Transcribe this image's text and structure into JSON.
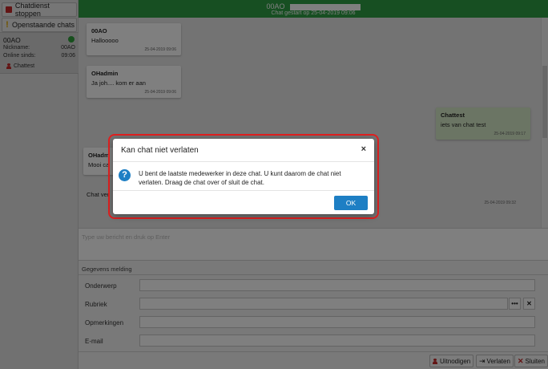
{
  "sidebar": {
    "stop_button": "Chatdienst stoppen",
    "open_chats_button": "Openstaande chats",
    "active_chat": {
      "id": "00AO",
      "status_color": "#2e9e3a",
      "nickname_label": "Nickname:",
      "nickname_value": "00AO",
      "online_label": "Online sinds:",
      "online_value": "09:06",
      "user": "Chattest"
    }
  },
  "header": {
    "title": "00AO",
    "subtitle": "Chat gestart op 25-04-2019 09:06",
    "color": "#2e9e45"
  },
  "messages": [
    {
      "from": "00AO",
      "text": "Hallooooo",
      "time": "25-04-2019 09:06"
    },
    {
      "from": "OHadmin",
      "text": "Ja joh.... kom er aan",
      "time": "25-04-2019 09:06"
    },
    {
      "from": "Chattest",
      "text": "iets van chat test",
      "time": "25-04-2019 09:17"
    },
    {
      "from": "OHadm",
      "text": "Mooi ca",
      "time": ""
    }
  ],
  "status_line": {
    "text": "Chat ver",
    "time": "25-04-2019 09:32"
  },
  "input": {
    "placeholder": "Type uw bericht en druk op Enter"
  },
  "form": {
    "title": "Gegevens melding",
    "fields": [
      {
        "label": "Onderwerp"
      },
      {
        "label": "Rubriek",
        "more": "•••",
        "clear": "✕"
      },
      {
        "label": "Opmerkingen"
      },
      {
        "label": "E-mail"
      }
    ]
  },
  "footer": {
    "invite": "Uitnodigen",
    "leave": "Verlaten",
    "close": "Sluiten"
  },
  "modal": {
    "title": "Kan chat niet verlaten",
    "close_glyph": "×",
    "icon": "?",
    "body": "U bent de laatste medewerker in deze chat. U kunt daarom de chat niet verlaten. Draag de chat over of sluit de chat.",
    "ok": "OK",
    "accent": "#1e7fc4",
    "highlight": "#e02020"
  }
}
